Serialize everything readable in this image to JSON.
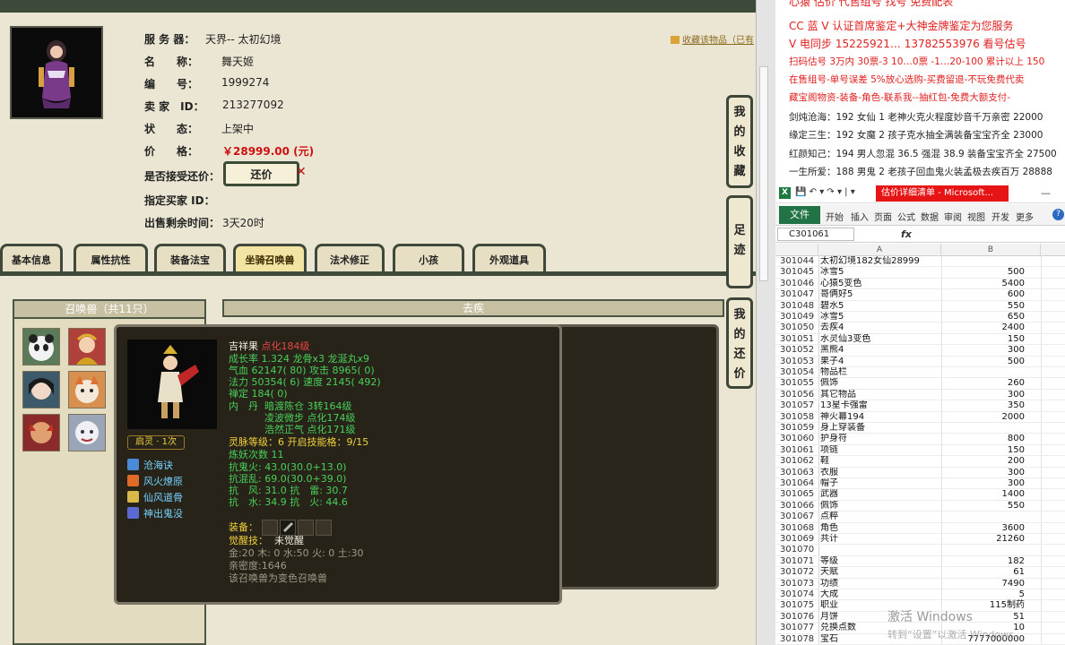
{
  "game": {
    "topbar": "",
    "collect_link": "收藏该物品（已有",
    "labels": {
      "server": "服 务 器：",
      "name": "名　　称：",
      "number": "编　　号：",
      "seller": "卖 家　ID：",
      "status": "状　　态：",
      "price": "价　　格：",
      "accept_counter": "是否接受还价：",
      "buyer": "指定买家 ID：",
      "time_left": "出售剩余时间："
    },
    "values": {
      "server": "天界-- 太初幻境",
      "name": "舞天姬",
      "number": "1999274",
      "seller": "213277092",
      "status": "上架中",
      "price": "￥28999.00 (元)",
      "buyer": "",
      "time_left": "3天20时"
    },
    "counter_button": "还价",
    "tabs": [
      "基本信息",
      "属性抗性",
      "装备法宝",
      "坐骑召唤兽",
      "法术修正",
      "小孩",
      "外观道具"
    ],
    "active_tab": "坐骑召唤兽",
    "side_tabs": [
      "我的收藏",
      "足迹",
      "我的还价"
    ],
    "pet_panel_title": "召唤兽（共11只）",
    "detail_panel_title": "去疾"
  },
  "popup": {
    "name": "吉祥果",
    "name_tag": "点化184级",
    "growth": "成长率 1.324 龙骨x3 龙涎丸x9",
    "hp": "气血 62147( 80) 攻击 8965( 0)",
    "mp": "法力 50354( 6) 速度 2145( 492)",
    "zen": "禅定 184( 0)",
    "neidan_label": "内　丹",
    "neidan": [
      "暗渡陈仓 3转164级",
      "凌波微步 点化174级",
      "浩然正气 点化171级"
    ],
    "spirit": "灵脉等级：6 开启技能格：9/15",
    "refine": "炼妖次数 11",
    "resist_ghost": "抗鬼火: 43.0(30.0+13.0)",
    "resist_chaos": "抗混乱: 69.0(30.0+39.0)",
    "resist_wind": "抗　风: 31.0 抗　雷: 30.7",
    "resist_water": "抗　水: 34.9 抗　火: 44.6",
    "equip_label": "装备：",
    "awaken_label": "觉醒技：",
    "awaken_value": "未觉醒",
    "elements": "金:20 木: 0 水:50 火: 0 土:30",
    "intimacy": "亲密度:1646",
    "note": "该召唤兽为变色召唤兽",
    "awake_badge": "启灵 · 1次",
    "skills": [
      "沧海诀",
      "风火燎原",
      "仙风道骨",
      "神出鬼没"
    ]
  },
  "right_text": [
    {
      "text": "心猿 估价 代售组号 找号 免费配表",
      "red": true
    },
    {
      "text": "CC 蓝 V 认证首席鉴定+大神金牌鉴定为您服务",
      "red": true
    },
    {
      "text": "V 电同步 15225921… 13782553976 看号估号",
      "red": true
    },
    {
      "text": "扫码估号 3万内 30票-3 10…0票 -1…20-100 累计以上 150",
      "red": true
    },
    {
      "text": "在售组号-单号误差 5%放心选购-买费留退-不玩免费代卖",
      "red": true
    },
    {
      "text": "藏宝阁物资-装备-角色-联系我--抽红包-免费大额支付-",
      "red": true
    },
    {
      "text": "剑炖沧海：192 女仙 1 老神火克火程度妙音千万亲密 22000",
      "red": false
    },
    {
      "text": "缘定三生：192 女魔 2 孩子克水抽全满装备宝宝齐全 23000",
      "red": false
    },
    {
      "text": "红颜知己：194 男人忽混 36.5 强混 38.9 装备宝宝齐全 27500",
      "red": false
    },
    {
      "text": "一生所爱：188 男鬼 2 老孩子回血鬼火装孟极去疾百万 28888",
      "red": false
    }
  ],
  "excel": {
    "qat": "💾 ↶ ▾ ↷ ▾ | ▾",
    "title": "估价详细清单 - Microsoft...",
    "file_tab": "文件",
    "ribbon_tabs": [
      "开始",
      "插入",
      "页面",
      "公式",
      "数据",
      "审阅",
      "视图",
      "开发",
      "更多"
    ],
    "name_box": "C301061",
    "fx": "fx",
    "col_a": "A",
    "col_b": "B",
    "rows": [
      [
        "301044",
        "太初幻境182女仙28999",
        ""
      ],
      [
        "301045",
        "冰雪5",
        "500"
      ],
      [
        "301046",
        "心猿5变色",
        "5400"
      ],
      [
        "301047",
        "哥俩好5",
        "600"
      ],
      [
        "301048",
        "碧水5",
        "550"
      ],
      [
        "301049",
        "冰雪5",
        "650"
      ],
      [
        "301050",
        "去疾4",
        "2400"
      ],
      [
        "301051",
        "水灵仙3变色",
        "150"
      ],
      [
        "301052",
        "黑熊4",
        "300"
      ],
      [
        "301053",
        "果子4",
        "500"
      ],
      [
        "301054",
        "物品栏",
        ""
      ],
      [
        "301055",
        "佩饰",
        "260"
      ],
      [
        "301056",
        "其它物品",
        "300"
      ],
      [
        "301057",
        "13星卡强雷",
        "350"
      ],
      [
        "301058",
        "神火幕194",
        "2000"
      ],
      [
        "301059",
        "身上穿装备",
        ""
      ],
      [
        "301060",
        "护身符",
        "800"
      ],
      [
        "301061",
        "项链",
        "150"
      ],
      [
        "301062",
        "鞋",
        "200"
      ],
      [
        "301063",
        "衣服",
        "300"
      ],
      [
        "301064",
        "帽子",
        "300"
      ],
      [
        "301065",
        "武器",
        "1400"
      ],
      [
        "301066",
        "佩饰",
        "550"
      ],
      [
        "301067",
        "点粹",
        ""
      ],
      [
        "301068",
        "角色",
        "3600"
      ],
      [
        "301069",
        "共计",
        "21260"
      ],
      [
        "301070",
        "",
        ""
      ],
      [
        "301071",
        "等级",
        "182"
      ],
      [
        "301072",
        "天赋",
        "61"
      ],
      [
        "301073",
        "功绩",
        "7490"
      ],
      [
        "301074",
        "大成",
        "5"
      ],
      [
        "301075",
        "职业",
        "115制药"
      ],
      [
        "301076",
        "月饼",
        "51"
      ],
      [
        "301077",
        "兑换点数",
        "10"
      ],
      [
        "301078",
        "宝石",
        "7777000000"
      ]
    ]
  },
  "watermark": {
    "line1": "激活 Windows",
    "line2": "转到“设置”以激活 Windows。"
  },
  "colors": {
    "price_red": "#cc1010",
    "excel_green": "#217346",
    "title_red": "#e61414"
  }
}
